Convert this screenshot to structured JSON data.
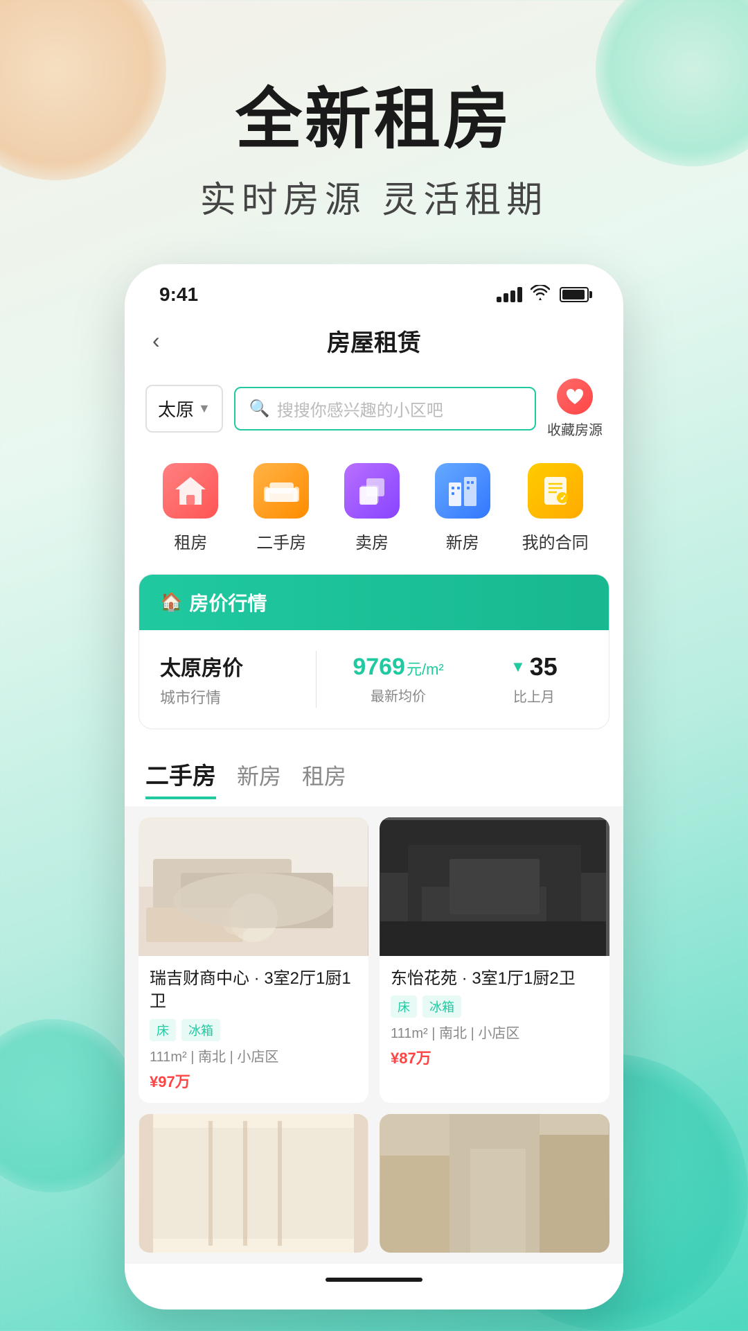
{
  "background": {
    "gradient": "linear-gradient(160deg, #f5f0e8 0%, #e8f8f0 30%, #b8ede0 60%, #4dd8c0 100%)"
  },
  "hero": {
    "title": "全新租房",
    "subtitle": "实时房源   灵活租期"
  },
  "phone": {
    "statusBar": {
      "time": "9:41"
    },
    "navBar": {
      "title": "房屋租赁",
      "backLabel": "‹"
    },
    "search": {
      "cityName": "太原",
      "placeholder": "搜搜你感兴趣的小区吧",
      "favoritesLabel": "收藏房源"
    },
    "categories": [
      {
        "label": "租房",
        "iconType": "house"
      },
      {
        "label": "二手房",
        "iconType": "sofa"
      },
      {
        "label": "卖房",
        "iconType": "cube-purple"
      },
      {
        "label": "新房",
        "iconType": "building"
      },
      {
        "label": "我的合同",
        "iconType": "contract"
      }
    ],
    "market": {
      "headerIcon": "🏠",
      "headerText": "房价行情",
      "cityName": "太原房价",
      "citySub": "城市行情",
      "price": "9769",
      "priceUnit": "元/m²",
      "priceLabel": "最新均价",
      "changeArrow": "▼",
      "changeValue": "35",
      "changeLabel": "比上月"
    },
    "tabs": [
      {
        "label": "二手房",
        "active": true
      },
      {
        "label": "新房",
        "active": false
      },
      {
        "label": "租房",
        "active": false
      }
    ],
    "listings": [
      {
        "title": "瑞吉财商中心 · 3室2厅1厨1卫",
        "tags": [
          "床",
          "冰箱"
        ],
        "meta": "111m² | 南北 | 小店区",
        "price": "¥97万",
        "imgType": "room1"
      },
      {
        "title": "东怡花苑 · 3室1厅1厨2卫",
        "tags": [
          "床",
          "冰箱"
        ],
        "meta": "111m² | 南北 | 小店区",
        "price": "¥87万",
        "imgType": "room2"
      },
      {
        "title": "",
        "tags": [],
        "meta": "",
        "price": "",
        "imgType": "room3"
      },
      {
        "title": "",
        "tags": [],
        "meta": "",
        "price": "",
        "imgType": "room4"
      }
    ]
  }
}
